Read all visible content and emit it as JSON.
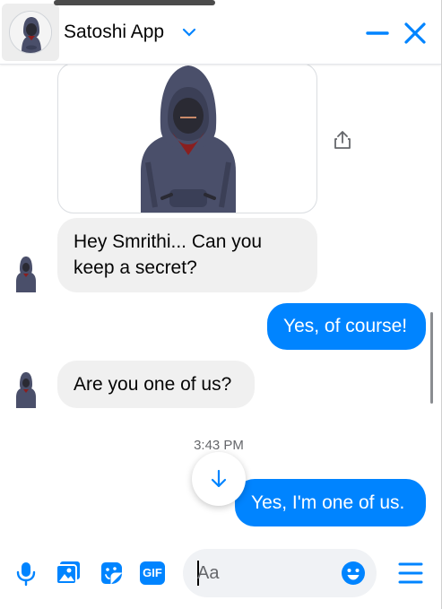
{
  "header": {
    "title": "Satoshi App",
    "avatar_icon": "hooded-figure-avatar",
    "chevron_icon": "chevron-down-icon",
    "minimize_icon": "minimize-icon",
    "close_icon": "close-icon"
  },
  "thread": {
    "sticker_icon": "hooded-figure-sticker",
    "share_icon": "share-icon",
    "messages": [
      {
        "direction": "incoming",
        "text": "Hey Smrithi... Can you keep a secret?"
      },
      {
        "direction": "outgoing",
        "text": "Yes, of course!"
      },
      {
        "direction": "incoming",
        "text": "Are you one of us?"
      },
      {
        "direction": "outgoing",
        "text": "Yes, I'm one of us."
      }
    ],
    "timestamp": "3:43 PM",
    "scroll_down_icon": "arrow-down-icon"
  },
  "composer": {
    "placeholder": "Aa",
    "value": "",
    "icons": [
      "microphone-icon",
      "photo-icon",
      "sticker-icon",
      "gif-icon",
      "emoji-icon",
      "menu-icon"
    ],
    "gif_label": "GIF"
  },
  "colors": {
    "accent": "#0084ff",
    "incoming_bubble": "#f0f0f0",
    "outgoing_bubble": "#0084ff",
    "input_bg": "#f0f2f5"
  }
}
